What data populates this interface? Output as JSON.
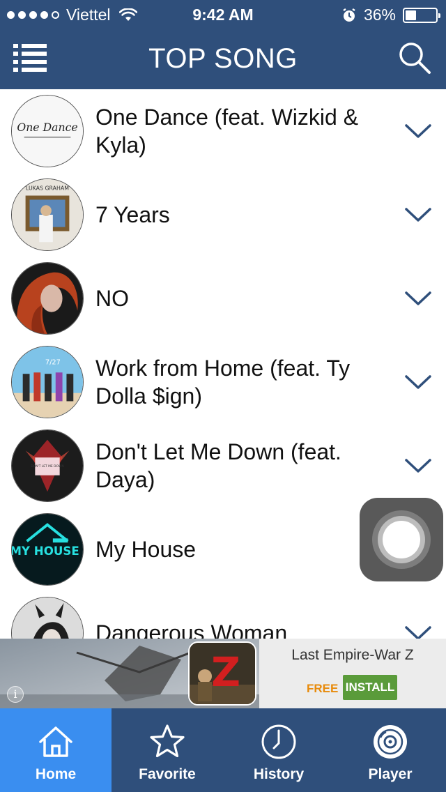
{
  "status_bar": {
    "carrier": "Viettel",
    "time": "9:42 AM",
    "battery_text": "36%",
    "battery_level": 0.36
  },
  "header": {
    "title": "TOP SONG",
    "menu_icon": "list-menu-icon",
    "search_icon": "search-icon"
  },
  "songs": [
    {
      "title": "One Dance (feat. Wizkid & Kyla)",
      "cover_text": "One Dance"
    },
    {
      "title": "7 Years",
      "cover_text": "LUKAS GRAHAM"
    },
    {
      "title": "NO"
    },
    {
      "title": "Work from Home (feat. Ty Dolla $ign)",
      "cover_text": "7/27"
    },
    {
      "title": "Don't Let Me Down (feat. Daya)",
      "cover_text": "DON'T LET ME DOWN"
    },
    {
      "title": "My House",
      "cover_text": "MY HOUSE"
    },
    {
      "title": "Dangerous Woman"
    }
  ],
  "ad": {
    "title": "Last Empire-War Z",
    "price": "FREE",
    "cta": "INSTALL",
    "info_symbol": "i",
    "icon_letter": "Z"
  },
  "tabs": [
    {
      "label": "Home",
      "icon": "home-icon",
      "active": true
    },
    {
      "label": "Favorite",
      "icon": "star-icon",
      "active": false
    },
    {
      "label": "History",
      "icon": "clock-icon",
      "active": false
    },
    {
      "label": "Player",
      "icon": "disc-icon",
      "active": false
    }
  ],
  "colors": {
    "header_bg": "#2f4f7b",
    "active_tab": "#3a8ef0",
    "chevron": "#2f4f7b",
    "install_bg": "#5a9b3a",
    "free_text": "#e88a0a"
  }
}
